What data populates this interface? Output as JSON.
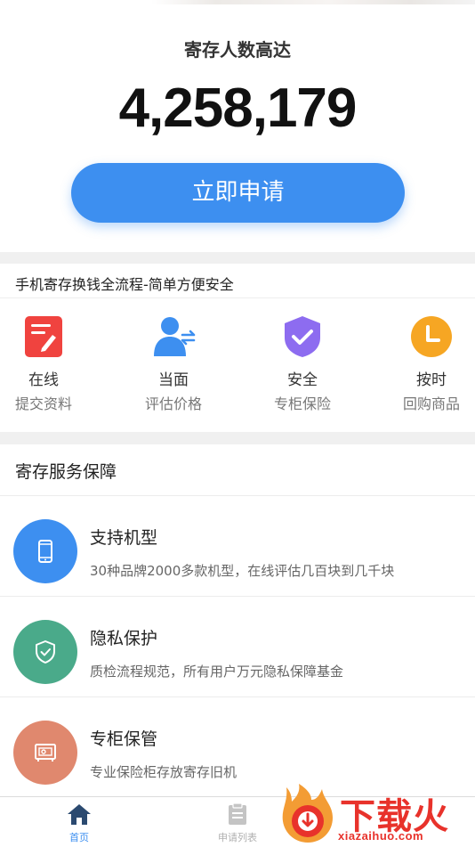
{
  "hero": {
    "title": "寄存人数高达",
    "count": "4,258,179",
    "apply_label": "立即申请"
  },
  "process": {
    "heading": "手机寄存换钱全流程-简单方便安全",
    "steps": [
      {
        "title": "在线",
        "subtitle": "提交资料",
        "icon": "edit-form-icon",
        "color": "#f0433f"
      },
      {
        "title": "当面",
        "subtitle": "评估价格",
        "icon": "person-exchange-icon",
        "color": "#3d8ff0"
      },
      {
        "title": "安全",
        "subtitle": "专柜保险",
        "icon": "shield-check-icon",
        "color": "#8d6cf0"
      },
      {
        "title": "按时",
        "subtitle": "回购商品",
        "icon": "clock-icon",
        "color": "#f6a623"
      }
    ]
  },
  "service": {
    "heading": "寄存服务保障",
    "items": [
      {
        "title": "支持机型",
        "desc": "30种品牌2000多款机型，在线评估几百块到几千块",
        "icon": "phone-icon",
        "color": "#3d8ff0"
      },
      {
        "title": "隐私保护",
        "desc": "质检流程规范，所有用户万元隐私保障基金",
        "icon": "shield-check-icon",
        "color": "#4aaa8a"
      },
      {
        "title": "专柜保管",
        "desc": "专业保险柜存放寄存旧机",
        "icon": "safe-box-icon",
        "color": "#e0886e"
      }
    ]
  },
  "tabbar": {
    "tabs": [
      {
        "label": "首页",
        "icon": "home-icon",
        "active": true
      },
      {
        "label": "申请列表",
        "icon": "clipboard-icon",
        "active": false
      }
    ],
    "active_color": "#3d8ff0",
    "inactive_color": "#c4c4c4"
  },
  "watermark": {
    "text": "下载火",
    "url": "xiazaihuo.com"
  }
}
